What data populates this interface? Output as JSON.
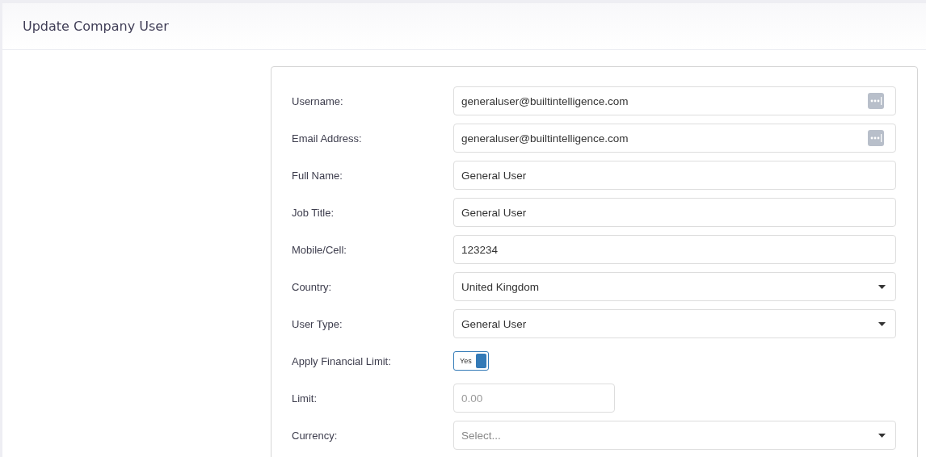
{
  "header": {
    "title": "Update Company User"
  },
  "fields": [
    {
      "kind": "menutext",
      "label": "Username:",
      "value": "generaluser@builtintelligence.com"
    },
    {
      "kind": "menutext",
      "label": "Email Address:",
      "value": "generaluser@builtintelligence.com"
    },
    {
      "kind": "text",
      "label": "Full Name:",
      "value": "General User"
    },
    {
      "kind": "text",
      "label": "Job Title:",
      "value": "General User"
    },
    {
      "kind": "text",
      "label": "Mobile/Cell:",
      "value": "123234"
    },
    {
      "kind": "select",
      "label": "Country:",
      "value": "United Kingdom"
    },
    {
      "kind": "select",
      "label": "User Type:",
      "value": "General User"
    },
    {
      "kind": "toggle",
      "label": "Apply Financial Limit:",
      "text": "Yes",
      "on": true
    },
    {
      "kind": "number",
      "label": "Limit:",
      "placeholder": "0.00"
    },
    {
      "kind": "select",
      "label": "Currency:",
      "placeholder": "Select..."
    }
  ]
}
